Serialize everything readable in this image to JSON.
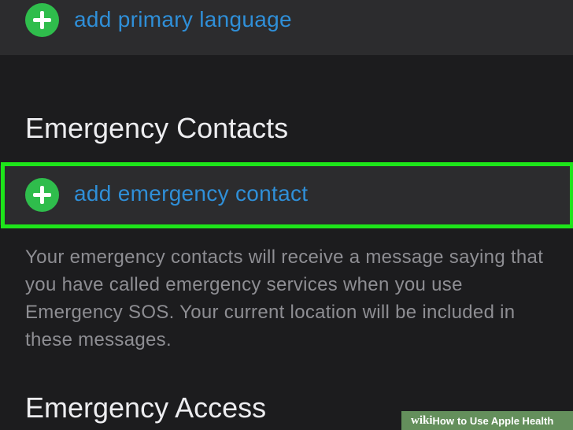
{
  "primary_language": {
    "add_label": "add primary language",
    "icon": "plus-circle-icon"
  },
  "emergency_contacts": {
    "title": "Emergency Contacts",
    "add_label": "add emergency contact",
    "icon": "plus-circle-icon",
    "description": "Your emergency contacts will receive a message saying that you have called emergency services when you use Emergency SOS. Your current location will be included in these messages."
  },
  "emergency_access": {
    "title": "Emergency Access"
  },
  "watermark": {
    "wiki": "wiki",
    "how": "How",
    "rest": "to Use Apple Health"
  },
  "colors": {
    "background": "#1c1c1e",
    "row_background": "#2c2c2e",
    "link_blue": "#2f8fd8",
    "plus_green": "#2fbd4c",
    "highlight_green": "#1ee51a"
  }
}
